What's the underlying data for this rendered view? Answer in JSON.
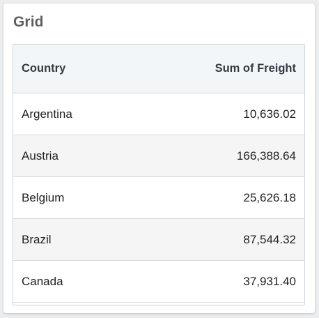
{
  "title": "Grid",
  "columns": [
    "Country",
    "Sum of Freight"
  ],
  "rows": [
    {
      "country": "Argentina",
      "freight": "10,636.02"
    },
    {
      "country": "Austria",
      "freight": "166,388.64"
    },
    {
      "country": "Belgium",
      "freight": "25,626.18"
    },
    {
      "country": "Brazil",
      "freight": "87,544.32"
    },
    {
      "country": "Canada",
      "freight": "37,931.40"
    }
  ]
}
